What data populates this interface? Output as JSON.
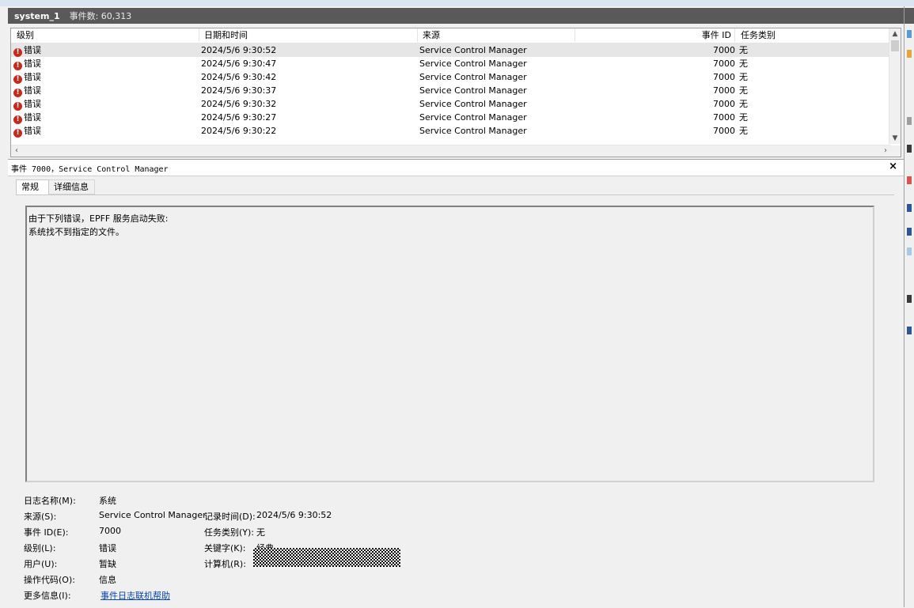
{
  "header": {
    "log_name": "system_1",
    "event_count": "事件数: 60,313"
  },
  "grid": {
    "columns": [
      "级别",
      "日期和时间",
      "来源",
      "事件 ID",
      "任务类别"
    ],
    "rows": [
      {
        "level": "错误",
        "date": "2024/5/6 9:30:52",
        "source": "Service Control Manager",
        "id": "7000",
        "task": "无"
      },
      {
        "level": "错误",
        "date": "2024/5/6 9:30:47",
        "source": "Service Control Manager",
        "id": "7000",
        "task": "无"
      },
      {
        "level": "错误",
        "date": "2024/5/6 9:30:42",
        "source": "Service Control Manager",
        "id": "7000",
        "task": "无"
      },
      {
        "level": "错误",
        "date": "2024/5/6 9:30:37",
        "source": "Service Control Manager",
        "id": "7000",
        "task": "无"
      },
      {
        "level": "错误",
        "date": "2024/5/6 9:30:32",
        "source": "Service Control Manager",
        "id": "7000",
        "task": "无"
      },
      {
        "level": "错误",
        "date": "2024/5/6 9:30:27",
        "source": "Service Control Manager",
        "id": "7000",
        "task": "无"
      },
      {
        "level": "错误",
        "date": "2024/5/6 9:30:22",
        "source": "Service Control Manager",
        "id": "7000",
        "task": "无"
      }
    ]
  },
  "detail": {
    "title": "事件 7000，Service Control Manager",
    "tabs": [
      "常规",
      "详细信息"
    ],
    "message_line1": "由于下列错误，EPFF 服务启动失败:",
    "message_line2": "系统找不到指定的文件。",
    "props": {
      "log_name_label": "日志名称(M):",
      "log_name": "系统",
      "source_label": "来源(S):",
      "source": "Service Control Manager",
      "logged_label": "记录时间(D):",
      "logged": "2024/5/6 9:30:52",
      "event_id_label": "事件 ID(E):",
      "event_id": "7000",
      "task_label": "任务类别(Y):",
      "task": "无",
      "level_label": "级别(L):",
      "level": "错误",
      "keywords_label": "关键字(K):",
      "keywords": "经典",
      "user_label": "用户(U):",
      "user": "暂缺",
      "computer_label": "计算机(R):",
      "opcode_label": "操作代码(O):",
      "opcode": "信息",
      "more_label": "更多信息(I):",
      "more_link": "事件日志联机帮助"
    }
  },
  "colors": {
    "titlebar": "#595959",
    "error": "#c42b1c",
    "link": "#0645ad"
  }
}
